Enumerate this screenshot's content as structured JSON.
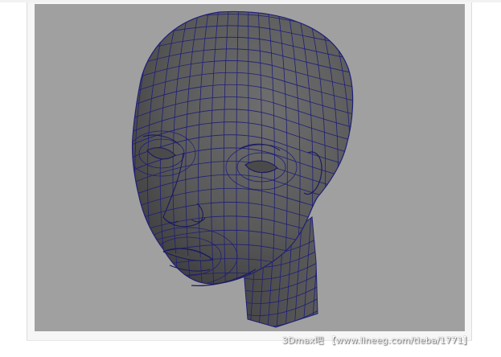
{
  "viewport": {
    "background": "#a0a0a0",
    "mesh_fill": "#5d5d5d",
    "wire_color": "#1e1e78"
  },
  "watermark": {
    "text": "3Dmax吧 【www.lineeg.com/tieba/1771】"
  }
}
